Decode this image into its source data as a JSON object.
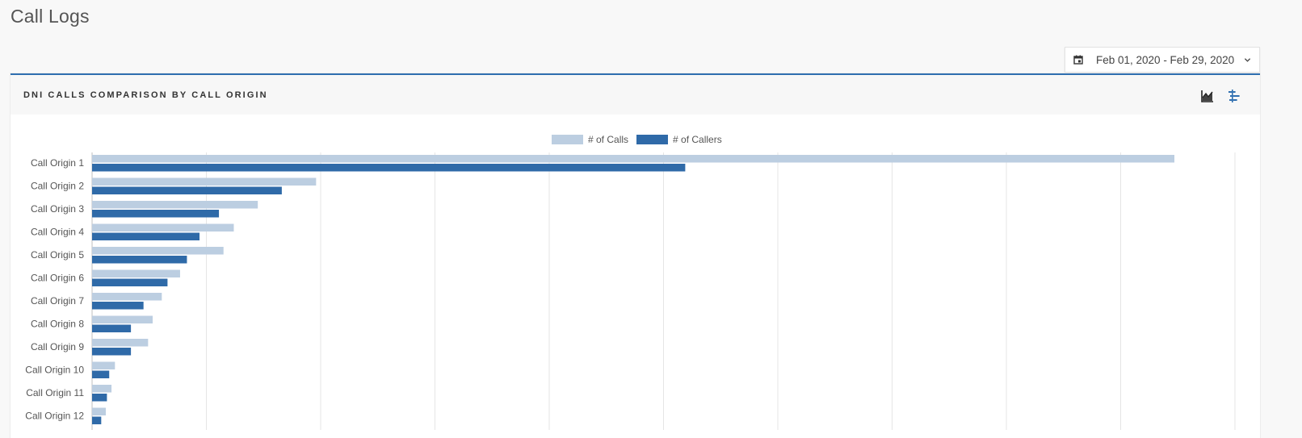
{
  "page": {
    "title": "Call Logs"
  },
  "date_range": {
    "label": "Feb 01, 2020 - Feb 29, 2020",
    "calendar_icon": "calendar-icon",
    "dropdown_icon": "chevron-down-icon"
  },
  "panel": {
    "title": "DNI CALLS COMPARISON BY CALL ORIGIN",
    "buttons": [
      {
        "name": "area-chart-icon"
      },
      {
        "name": "bar-chart-horizontal-icon"
      }
    ]
  },
  "colors": {
    "calls": "#bccee1",
    "callers": "#2f6aa8",
    "accent": "#2f6fb0",
    "grid": "#e5e5e5"
  },
  "chart_data": {
    "type": "bar",
    "orientation": "horizontal",
    "categories": [
      "Call Origin 1",
      "Call Origin 2",
      "Call Origin 3",
      "Call Origin 4",
      "Call Origin 5",
      "Call Origin 6",
      "Call Origin 7",
      "Call Origin 8",
      "Call Origin 9",
      "Call Origin 10",
      "Call Origin 11",
      "Call Origin 12"
    ],
    "series": [
      {
        "name": "# of Calls",
        "values": [
          947,
          196,
          145,
          124,
          115,
          77,
          61,
          53,
          49,
          20,
          17,
          12
        ]
      },
      {
        "name": "# of Callers",
        "values": [
          519,
          166,
          111,
          94,
          83,
          66,
          45,
          34,
          34,
          15,
          13,
          8
        ]
      }
    ],
    "xlim": [
      0,
      1000
    ],
    "legend_position": "top-center",
    "grid": true
  }
}
